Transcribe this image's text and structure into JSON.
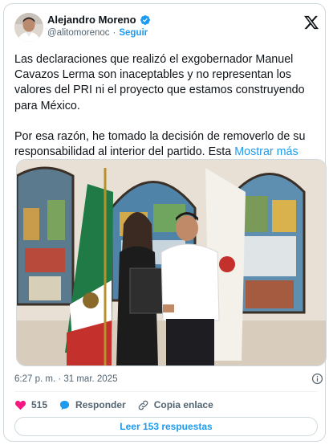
{
  "author": {
    "display_name": "Alejandro Moreno",
    "handle": "@alitomorenoc",
    "separator": "·",
    "follow_label": "Seguir",
    "verified": true
  },
  "tweet": {
    "paragraph1": "Las declaraciones que realizó el exgobernador Manuel Cavazos Lerma son inaceptables y no representan los valores del PRI ni el proyecto que estamos construyendo para México.",
    "paragraph2": "Por esa razón, he tomado la decisión de removerlo de su responsabilidad al interior del partido. Esta",
    "show_more": "Mostrar más"
  },
  "meta": {
    "timestamp": "6:27 p. m. · 31 mar. 2025"
  },
  "actions": {
    "like_count": "515",
    "reply_label": "Responder",
    "copy_label": "Copia enlace"
  },
  "footer": {
    "replies_label": "Leer 153 respuestas"
  },
  "colors": {
    "accent": "#1d9bf0",
    "like": "#f91880",
    "text": "#0f1419",
    "muted": "#536471",
    "border": "#cfd9de"
  },
  "icons": [
    "x-logo-icon",
    "verified-badge-icon",
    "heart-icon",
    "reply-bubble-icon",
    "link-icon",
    "info-icon"
  ]
}
